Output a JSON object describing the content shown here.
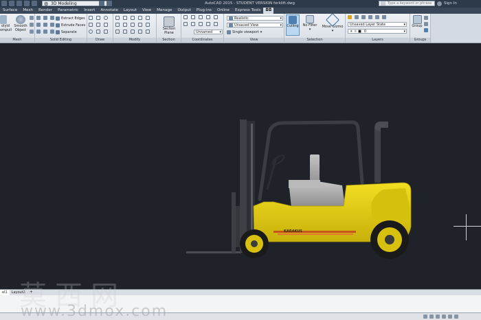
{
  "titlebar": {
    "workspace": "3D Modeling",
    "title": "AutoCAD 2015 - STUDENT VERSION   forklift.dwg",
    "search_placeholder": "Type a keyword or phrase",
    "signin": "Sign In"
  },
  "tabs": [
    "Surface",
    "Mesh",
    "Render",
    "Parametric",
    "Insert",
    "Annotate",
    "Layout",
    "View",
    "Manage",
    "Output",
    "Plug-ins",
    "Online",
    "Express Tools",
    "◘◘"
  ],
  "ribbon": {
    "mesh": {
      "label": "Mesh",
      "cut_left": "olyid",
      "cut_left2": "ompull",
      "smooth_line1": "Smooth",
      "smooth_line2": "Object"
    },
    "solid_editing": {
      "label": "Solid Editing",
      "items": [
        "Extract Edges",
        "Extrude Faces",
        "Separate"
      ]
    },
    "draw": {
      "label": "Draw"
    },
    "modify": {
      "label": "Modify"
    },
    "section": {
      "label": "Section",
      "btn_line1": "Section",
      "btn_line2": "Plane"
    },
    "coordinates": {
      "label": "Coordinates",
      "ucs": "Unnamed"
    },
    "view": {
      "label": "View",
      "visual_style": "Realistic",
      "named_view": "Unsaved View",
      "viewport": "Single viewport"
    },
    "selection": {
      "label": "Selection",
      "culling": "Culling",
      "no_filter": "No Filter",
      "move_gizmo": "Move Gizmo"
    },
    "layers": {
      "label": "Layers",
      "state": "Unsaved Layer State",
      "current": "0"
    },
    "groups": {
      "label": "Groups",
      "group": "Group"
    }
  },
  "model": {
    "brand_plate": "KARAKUS"
  },
  "layout_tabs": [
    "el1",
    "Layout2"
  ],
  "watermark": {
    "cn": "莫西网",
    "url": "www.3dmox.com"
  },
  "colors": {
    "canvas": "#1f2329",
    "forklift_yellow": "#e2cc10",
    "stripe_orange": "#d9611c",
    "seat_grey": "#a9a9a9"
  }
}
